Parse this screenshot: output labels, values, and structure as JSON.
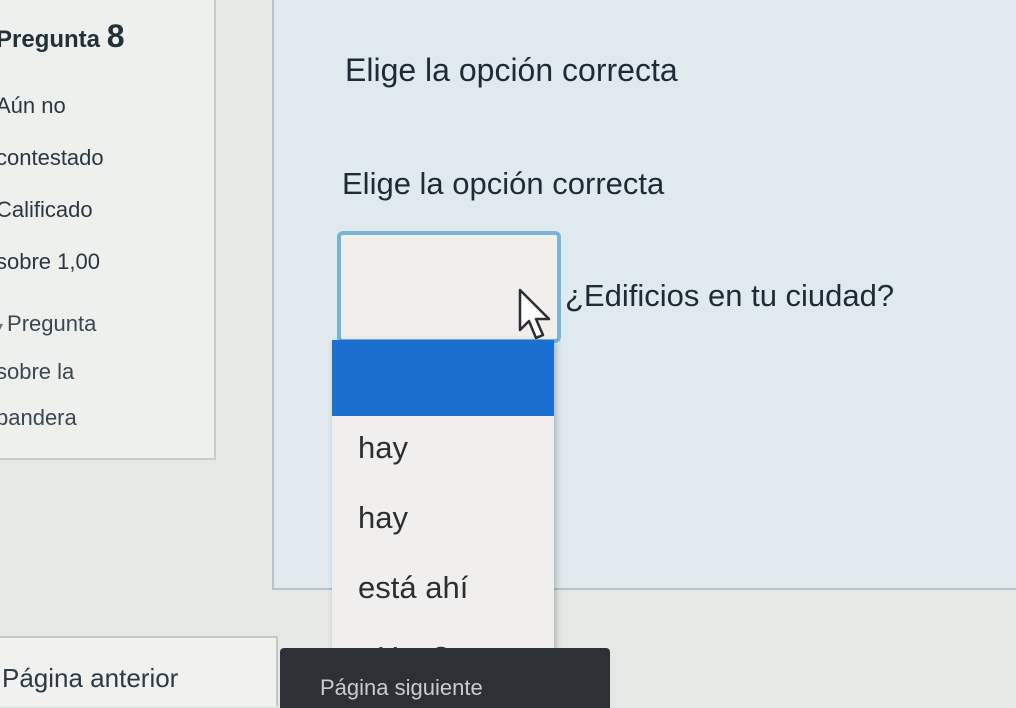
{
  "info": {
    "title_prefix": "Pregunta",
    "title_number": "8",
    "status_lines": [
      "Aún no",
      "contestado",
      "Calificado",
      "sobre 1,00"
    ],
    "flag_lines": [
      "Pregunta",
      "sobre la",
      "bandera"
    ]
  },
  "question": {
    "prompt_1": "Elige la opción correcta",
    "prompt_2": "Elige la opción correcta",
    "text": "¿Edificios en tu ciudad?",
    "select_value": "",
    "options": [
      "",
      "hay",
      "hay",
      "está ahí",
      "¿Hay?"
    ],
    "highlight_color": "#1a6fcf"
  },
  "nav": {
    "prev_label": "Página anterior",
    "next_label": "Página siguiente"
  }
}
